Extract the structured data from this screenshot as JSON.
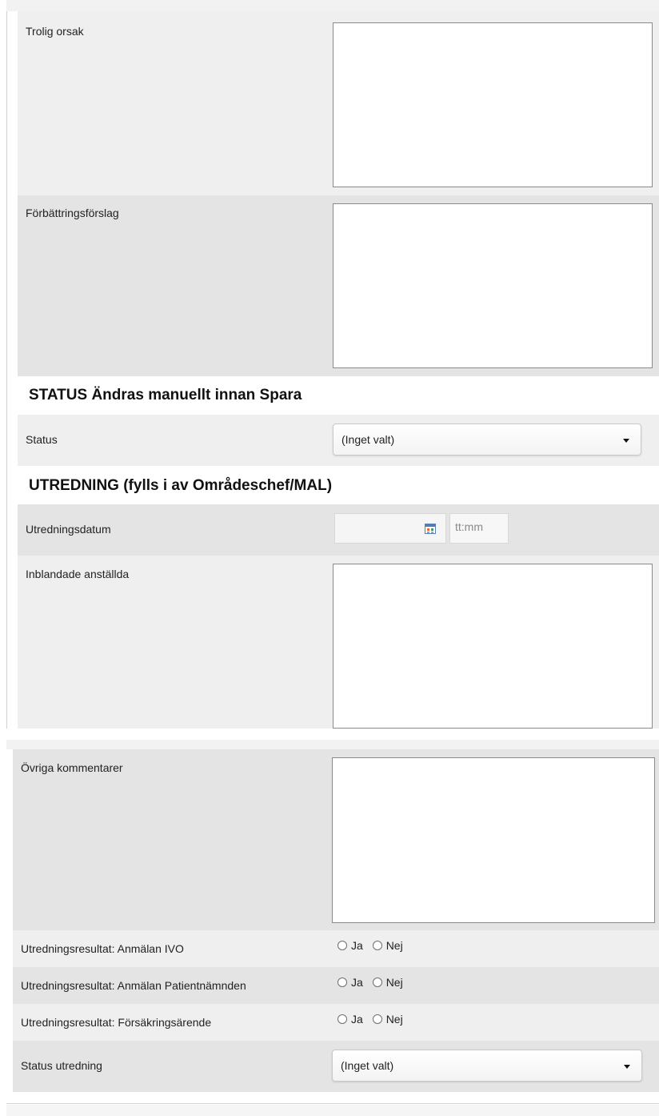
{
  "section1": {
    "fields": {
      "trolig_orsak": {
        "label": "Trolig orsak",
        "value": ""
      },
      "forbattringsforslag": {
        "label": "Förbättringsförslag",
        "value": ""
      },
      "status": {
        "label": "Status",
        "selected": "(Inget valt)"
      },
      "utredningsdatum": {
        "label": "Utredningsdatum",
        "date_value": "",
        "time_placeholder": "tt:mm"
      },
      "inblandade_anstallda": {
        "label": "Inblandade anställda",
        "value": ""
      }
    },
    "headings": {
      "status_heading": "STATUS Ändras manuellt innan Spara",
      "utredning_heading": "UTREDNING (fylls i av Områdeschef/MAL)"
    }
  },
  "section2": {
    "ovriga_kommentarer": {
      "label": "Övriga kommentarer",
      "value": ""
    },
    "radios": [
      {
        "label": "Utredningsresultat: Anmälan IVO",
        "yes": "Ja",
        "no": "Nej"
      },
      {
        "label": "Utredningsresultat: Anmälan Patientnämnden",
        "yes": "Ja",
        "no": "Nej"
      },
      {
        "label": "Utredningsresultat: Försäkringsärende",
        "yes": "Ja",
        "no": "Nej"
      }
    ],
    "status_utredning": {
      "label": "Status utredning",
      "selected": "(Inget valt)"
    }
  },
  "icons": {
    "calendar": "calendar-icon",
    "dropdown": "chevron-down-icon",
    "radio": "radio-button"
  },
  "colors": {
    "row_light": "#efefef",
    "row_dark": "#e4e4e4",
    "textarea_border": "#8a8a8a"
  }
}
